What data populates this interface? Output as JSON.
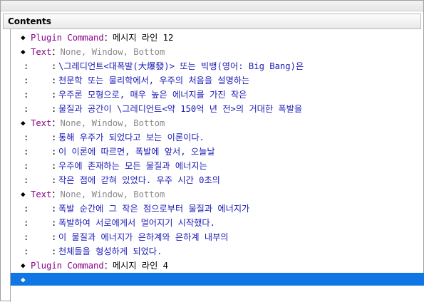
{
  "panel": {
    "title": "Contents"
  },
  "rows": [
    {
      "kind": "command",
      "name": "Plugin Command",
      "sep": "：",
      "value": "메시지 라인 12"
    },
    {
      "kind": "command",
      "name": "Text",
      "sep": "：",
      "params": "None, Window, Bottom"
    },
    {
      "kind": "cont",
      "colon1": ":",
      "colon2": ":",
      "text": "\\그레디언트<대폭발(大爆發)> 또는 빅뱅(영어: Big Bang)은"
    },
    {
      "kind": "cont",
      "colon1": ":",
      "colon2": ":",
      "text": "천문학 또는 물리학에서, 우주의 처음을 설명하는"
    },
    {
      "kind": "cont",
      "colon1": ":",
      "colon2": ":",
      "text": "우주론 모형으로, 매우 높은 에너지를 가진 작은"
    },
    {
      "kind": "cont",
      "colon1": ":",
      "colon2": ":",
      "text": "물질과 공간이 \\그레디언트<약 150억 년 전>의 거대한 폭발을"
    },
    {
      "kind": "command",
      "name": "Text",
      "sep": "：",
      "params": "None, Window, Bottom"
    },
    {
      "kind": "cont",
      "colon1": ":",
      "colon2": ":",
      "text": "통해 우주가 되었다고 보는 이론이다."
    },
    {
      "kind": "cont",
      "colon1": ":",
      "colon2": ":",
      "text": "이 이론에 따르면, 폭발에 앞서, 오늘날"
    },
    {
      "kind": "cont",
      "colon1": ":",
      "colon2": ":",
      "text": "우주에 존재하는 모든 물질과 에너지는"
    },
    {
      "kind": "cont",
      "colon1": ":",
      "colon2": ":",
      "text": "작은 점에 갇혀 있었다. 우주 시간 0초의"
    },
    {
      "kind": "command",
      "name": "Text",
      "sep": "：",
      "params": "None, Window, Bottom"
    },
    {
      "kind": "cont",
      "colon1": ":",
      "colon2": ":",
      "text": "폭발 순간에 그 작은 점으로부터 물질과 에너지가"
    },
    {
      "kind": "cont",
      "colon1": ":",
      "colon2": ":",
      "text": "폭발하여 서로에게서 멀어지기 시작했다."
    },
    {
      "kind": "cont",
      "colon1": ":",
      "colon2": ":",
      "text": "이 물질과 에너지가 은하계와 은하계 내부의"
    },
    {
      "kind": "cont",
      "colon1": ":",
      "colon2": ":",
      "text": "천체들을 형성하게 되었다."
    },
    {
      "kind": "command",
      "name": "Plugin Command",
      "sep": "：",
      "value": "메시지 라인 4"
    },
    {
      "kind": "empty"
    }
  ],
  "icons": {
    "bullet": "diamond-bullet-icon"
  },
  "colors": {
    "command": "#8b008b",
    "message_text": "#1b1bb8",
    "params": "#8a8a8a",
    "selection": "#1076e3"
  }
}
